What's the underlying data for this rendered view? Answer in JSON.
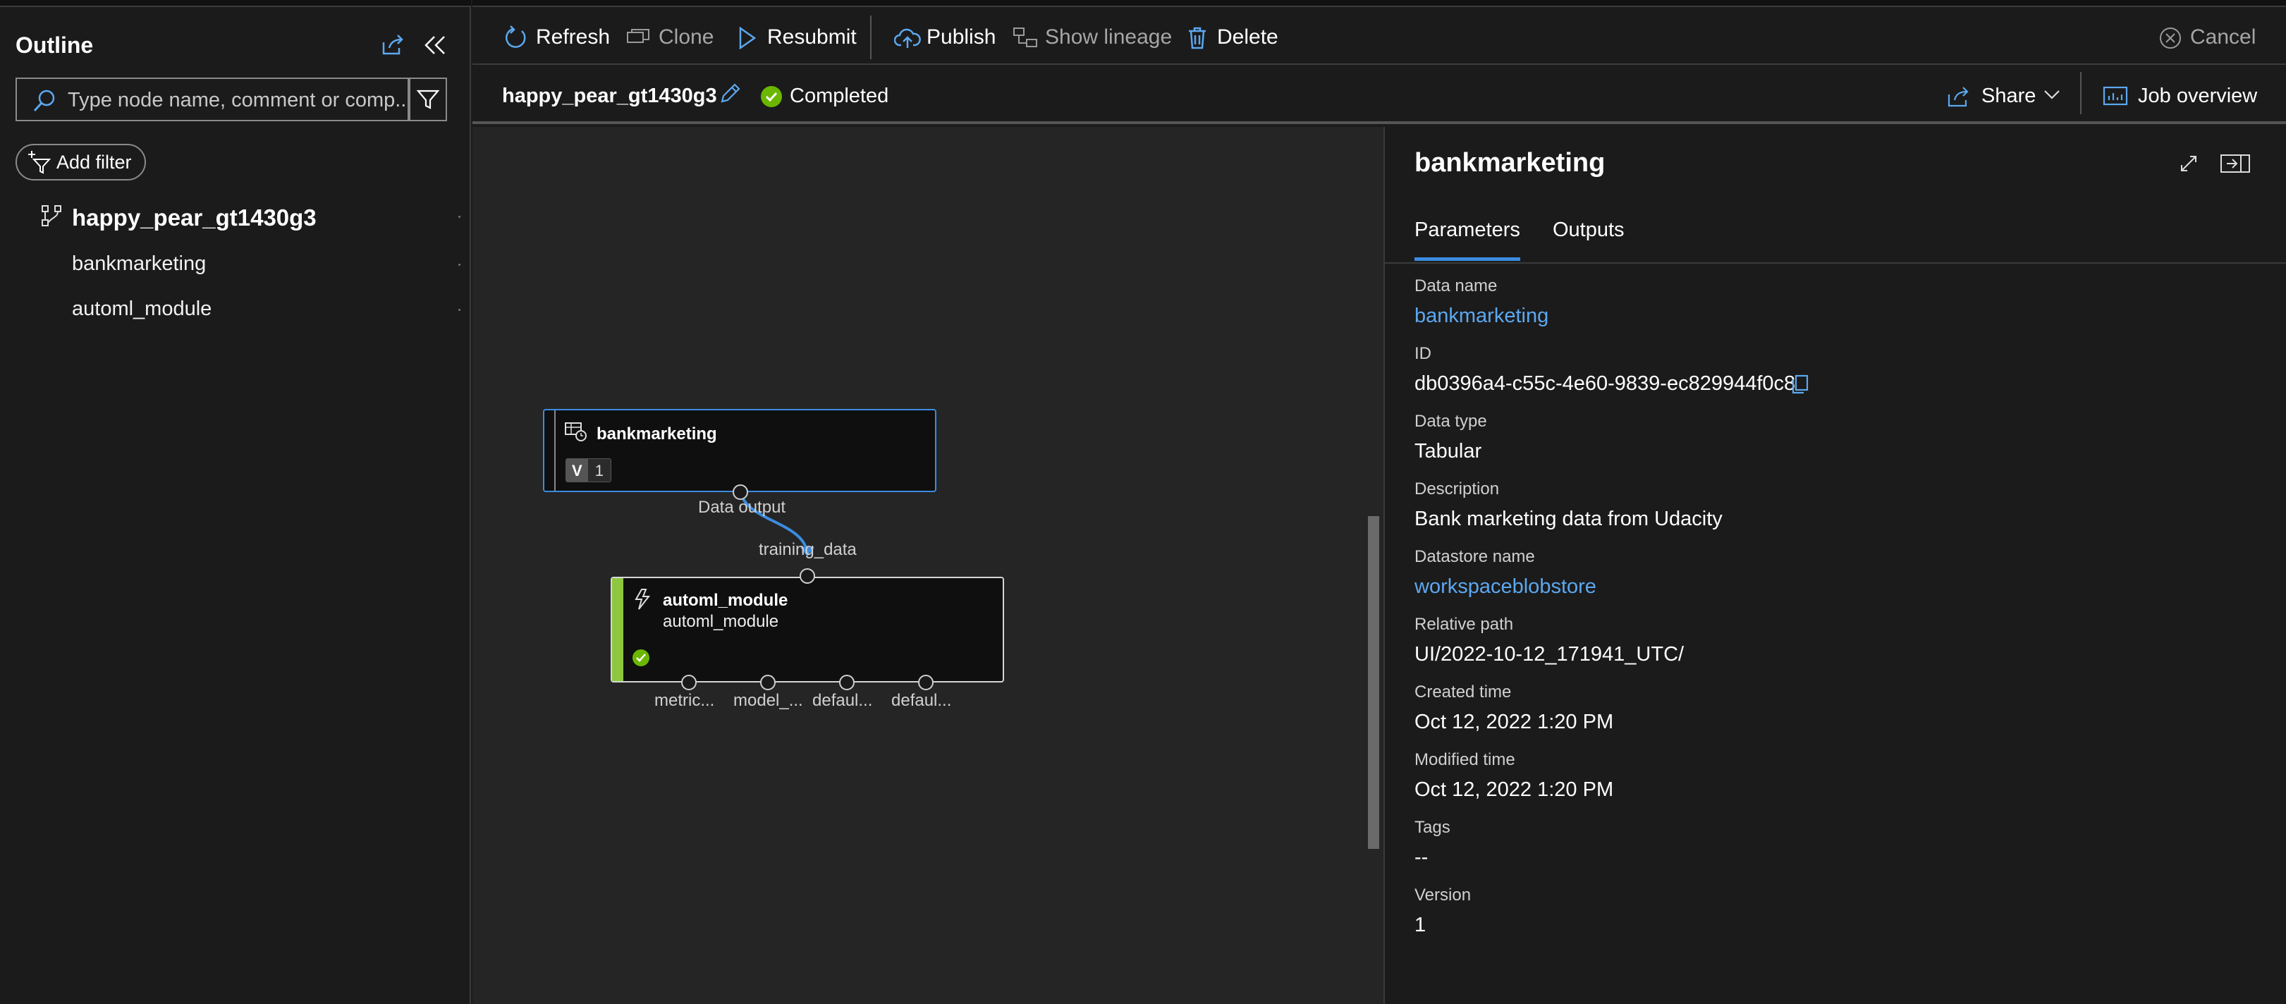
{
  "sidebar": {
    "title": "Outline",
    "search_placeholder": "Type node name, comment or comp...",
    "add_filter_label": "Add filter",
    "tree": {
      "root": "happy_pear_gt1430g3",
      "children": [
        "bankmarketing",
        "automl_module"
      ]
    }
  },
  "toolbar": {
    "refresh": "Refresh",
    "clone": "Clone",
    "resubmit": "Resubmit",
    "publish": "Publish",
    "show_lineage": "Show lineage",
    "delete": "Delete",
    "cancel": "Cancel"
  },
  "job": {
    "name": "happy_pear_gt1430g3",
    "status": "Completed",
    "share_label": "Share",
    "job_overview_label": "Job overview"
  },
  "canvas": {
    "node_dataset": {
      "title": "bankmarketing",
      "version_prefix": "V",
      "version": "1",
      "output_label": "Data output"
    },
    "node_module": {
      "title": "automl_module",
      "subtitle": "automl_module",
      "input_label": "training_data",
      "outputs": [
        "metric...",
        "model_...",
        "defaul...",
        "defaul..."
      ]
    }
  },
  "details": {
    "title": "bankmarketing",
    "tabs": [
      "Parameters",
      "Outputs"
    ],
    "active_tab": "Parameters",
    "fields": {
      "data_name": {
        "label": "Data name",
        "value": "bankmarketing"
      },
      "id": {
        "label": "ID",
        "value": "db0396a4-c55c-4e60-9839-ec829944f0c8"
      },
      "data_type": {
        "label": "Data type",
        "value": "Tabular"
      },
      "description": {
        "label": "Description",
        "value": "Bank marketing data from Udacity"
      },
      "datastore": {
        "label": "Datastore name",
        "value": "workspaceblobstore"
      },
      "relative_path": {
        "label": "Relative path",
        "value": "UI/2022-10-12_171941_UTC/"
      },
      "created": {
        "label": "Created time",
        "value": "Oct 12, 2022 1:20 PM"
      },
      "modified": {
        "label": "Modified time",
        "value": "Oct 12, 2022 1:20 PM"
      },
      "tags": {
        "label": "Tags",
        "value": "--"
      },
      "version": {
        "label": "Version",
        "value": "1"
      }
    }
  },
  "colors": {
    "accent": "#3b8ce0",
    "link": "#5ca8f0",
    "success": "#6bb700",
    "background": "#1b1b1b",
    "canvas": "#252525"
  }
}
